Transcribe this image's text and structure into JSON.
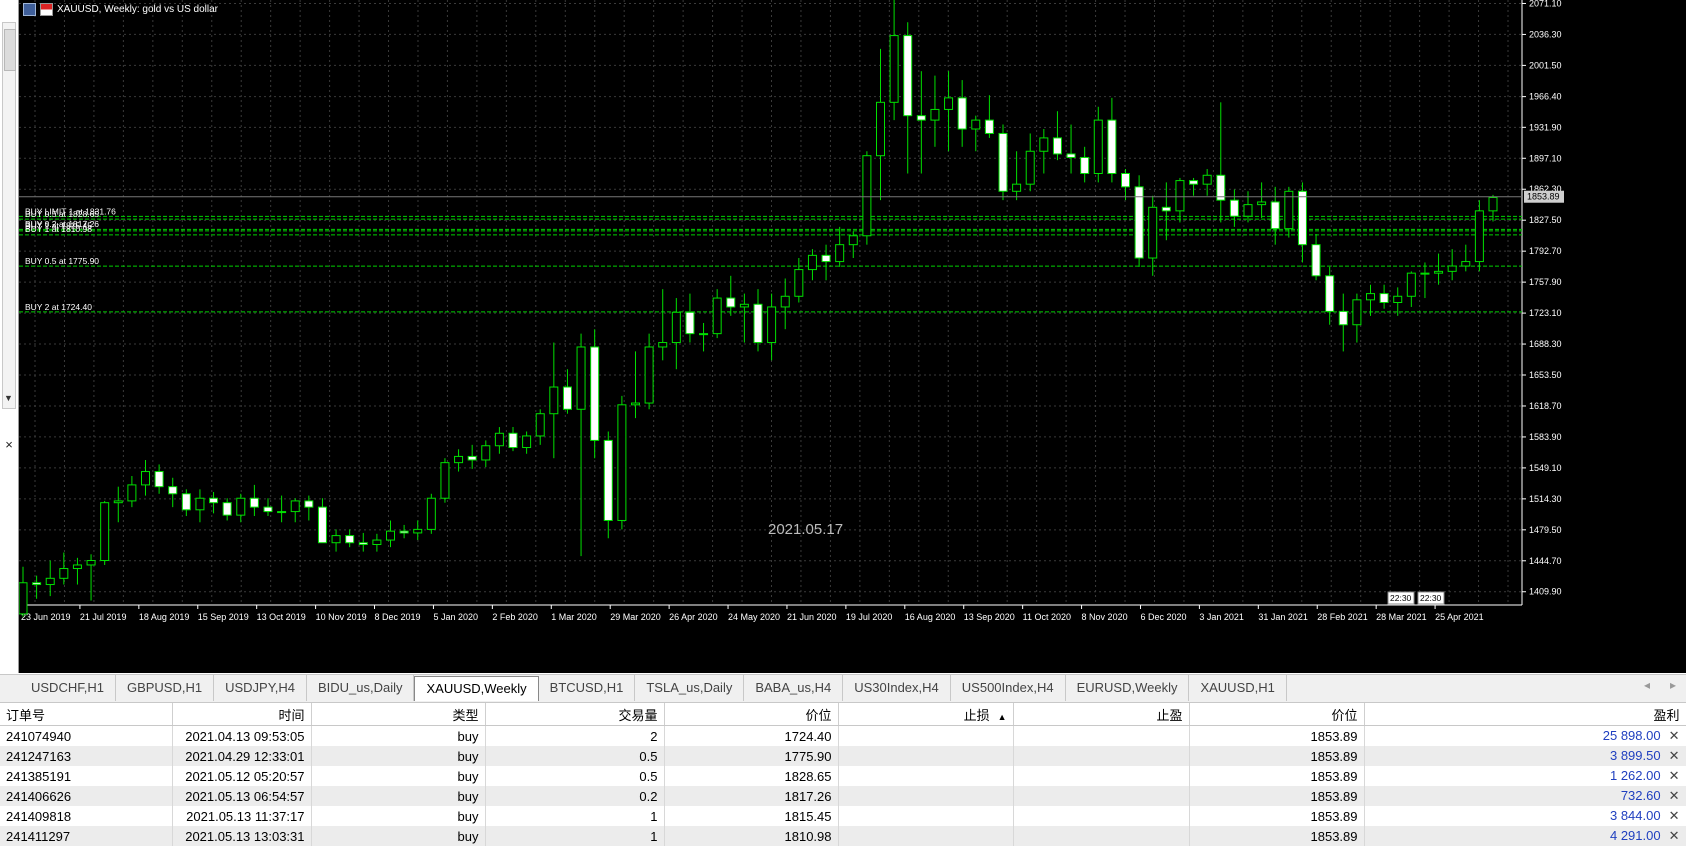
{
  "chart": {
    "title": "XAUUSD, Weekly:  gold vs US dollar",
    "date_watermark": "2021.05.17",
    "current_price": "1853.89",
    "price_ticks": [
      "2071.10",
      "2036.30",
      "2001.50",
      "1966.40",
      "1931.90",
      "1897.10",
      "1862.30",
      "1827.50",
      "1792.70",
      "1757.90",
      "1723.10",
      "1688.30",
      "1653.50",
      "1618.70",
      "1583.90",
      "1549.10",
      "1514.30",
      "1479.50",
      "1444.70",
      "1409.90"
    ],
    "date_ticks": [
      "23 Jun 2019",
      "21 Jul 2019",
      "18 Aug 2019",
      "15 Sep 2019",
      "13 Oct 2019",
      "10 Nov 2019",
      "8 Dec 2019",
      "5 Jan 2020",
      "2 Feb 2020",
      "1 Mar 2020",
      "29 Mar 2020",
      "26 Apr 2020",
      "24 May 2020",
      "21 Jun 2020",
      "19 Jul 2020",
      "16 Aug 2020",
      "13 Sep 2020",
      "11 Oct 2020",
      "8 Nov 2020",
      "6 Dec 2020",
      "3 Jan 2021",
      "31 Jan 2021",
      "28 Feb 2021",
      "28 Mar 2021",
      "25 Apr 2021"
    ],
    "order_lines": [
      {
        "label": "BUY LIMIT 1 at 1831.76",
        "price": 1831.76
      },
      {
        "label": "BUY 0.5 at 1828.65",
        "price": 1828.65
      },
      {
        "label": "BUY 0.2 at 1817.26",
        "price": 1817.26
      },
      {
        "label": "BUY 1 at 1815.45",
        "price": 1815.45
      },
      {
        "label": "BUY 1 at 1810.98",
        "price": 1810.98
      },
      {
        "label": "BUY 0.5 at 1775.90",
        "price": 1775.9
      },
      {
        "label": "BUY 2 at 1724.40",
        "price": 1724.4
      }
    ],
    "time_tags": [
      "22:30",
      "22:30"
    ],
    "colors": {
      "background": "#000000",
      "grid": "#3a3a3a",
      "candle_up": "#000000",
      "candle_down": "#ffffff",
      "wick": "#00e000",
      "order_line": "#00d000",
      "text": "#ffffff"
    }
  },
  "chart_data": {
    "type": "candlestick",
    "title": "XAUUSD, Weekly:  gold vs US dollar",
    "ylim": [
      1395,
      2075
    ],
    "candles": [
      [
        1385,
        1438,
        1382,
        1420
      ],
      [
        1420,
        1428,
        1402,
        1418
      ],
      [
        1418,
        1445,
        1405,
        1425
      ],
      [
        1425,
        1454,
        1418,
        1436
      ],
      [
        1436,
        1448,
        1418,
        1440
      ],
      [
        1440,
        1452,
        1400,
        1445
      ],
      [
        1445,
        1512,
        1440,
        1510
      ],
      [
        1510,
        1528,
        1488,
        1512
      ],
      [
        1512,
        1540,
        1505,
        1530
      ],
      [
        1530,
        1558,
        1518,
        1545
      ],
      [
        1545,
        1553,
        1520,
        1528
      ],
      [
        1528,
        1538,
        1505,
        1520
      ],
      [
        1520,
        1525,
        1495,
        1502
      ],
      [
        1502,
        1525,
        1488,
        1515
      ],
      [
        1515,
        1522,
        1498,
        1510
      ],
      [
        1510,
        1515,
        1490,
        1496
      ],
      [
        1496,
        1520,
        1488,
        1515
      ],
      [
        1515,
        1530,
        1495,
        1505
      ],
      [
        1505,
        1515,
        1495,
        1500
      ],
      [
        1500,
        1518,
        1488,
        1500
      ],
      [
        1500,
        1515,
        1488,
        1512
      ],
      [
        1512,
        1518,
        1490,
        1505
      ],
      [
        1505,
        1515,
        1465,
        1465
      ],
      [
        1465,
        1480,
        1455,
        1473
      ],
      [
        1473,
        1480,
        1460,
        1465
      ],
      [
        1465,
        1476,
        1455,
        1463
      ],
      [
        1463,
        1475,
        1455,
        1468
      ],
      [
        1468,
        1490,
        1460,
        1478
      ],
      [
        1478,
        1485,
        1470,
        1476
      ],
      [
        1476,
        1490,
        1468,
        1480
      ],
      [
        1480,
        1520,
        1475,
        1515
      ],
      [
        1515,
        1560,
        1510,
        1555
      ],
      [
        1555,
        1570,
        1545,
        1562
      ],
      [
        1562,
        1575,
        1548,
        1558
      ],
      [
        1558,
        1580,
        1550,
        1574
      ],
      [
        1574,
        1595,
        1565,
        1588
      ],
      [
        1588,
        1595,
        1568,
        1572
      ],
      [
        1572,
        1590,
        1565,
        1585
      ],
      [
        1585,
        1615,
        1575,
        1610
      ],
      [
        1610,
        1690,
        1560,
        1640
      ],
      [
        1640,
        1660,
        1610,
        1615
      ],
      [
        1615,
        1700,
        1450,
        1685
      ],
      [
        1685,
        1705,
        1560,
        1580
      ],
      [
        1580,
        1590,
        1470,
        1490
      ],
      [
        1490,
        1630,
        1480,
        1620
      ],
      [
        1620,
        1680,
        1605,
        1622
      ],
      [
        1622,
        1700,
        1615,
        1685
      ],
      [
        1685,
        1750,
        1670,
        1690
      ],
      [
        1690,
        1740,
        1660,
        1724
      ],
      [
        1724,
        1745,
        1690,
        1700
      ],
      [
        1700,
        1712,
        1680,
        1700
      ],
      [
        1700,
        1750,
        1695,
        1740
      ],
      [
        1740,
        1765,
        1720,
        1730
      ],
      [
        1730,
        1745,
        1690,
        1733
      ],
      [
        1733,
        1750,
        1680,
        1690
      ],
      [
        1690,
        1745,
        1670,
        1730
      ],
      [
        1730,
        1762,
        1705,
        1742
      ],
      [
        1742,
        1785,
        1735,
        1772
      ],
      [
        1772,
        1795,
        1760,
        1788
      ],
      [
        1788,
        1800,
        1760,
        1781
      ],
      [
        1781,
        1820,
        1775,
        1800
      ],
      [
        1800,
        1815,
        1785,
        1810
      ],
      [
        1810,
        1905,
        1800,
        1900
      ],
      [
        1900,
        2020,
        1850,
        1960
      ],
      [
        1960,
        2075,
        1940,
        2035
      ],
      [
        2035,
        2050,
        1880,
        1945
      ],
      [
        1945,
        1995,
        1880,
        1940
      ],
      [
        1940,
        1990,
        1910,
        1952
      ],
      [
        1952,
        1995,
        1905,
        1965
      ],
      [
        1965,
        1985,
        1910,
        1930
      ],
      [
        1930,
        1945,
        1905,
        1940
      ],
      [
        1940,
        1968,
        1920,
        1925
      ],
      [
        1925,
        1935,
        1850,
        1860
      ],
      [
        1860,
        1905,
        1850,
        1868
      ],
      [
        1868,
        1925,
        1860,
        1905
      ],
      [
        1905,
        1930,
        1880,
        1920
      ],
      [
        1920,
        1950,
        1895,
        1902
      ],
      [
        1902,
        1935,
        1880,
        1898
      ],
      [
        1898,
        1910,
        1870,
        1880
      ],
      [
        1880,
        1955,
        1870,
        1940
      ],
      [
        1940,
        1965,
        1870,
        1880
      ],
      [
        1880,
        1885,
        1850,
        1865
      ],
      [
        1865,
        1878,
        1775,
        1785
      ],
      [
        1785,
        1855,
        1765,
        1842
      ],
      [
        1842,
        1870,
        1805,
        1838
      ],
      [
        1838,
        1875,
        1825,
        1872
      ],
      [
        1872,
        1875,
        1855,
        1868
      ],
      [
        1868,
        1885,
        1855,
        1878
      ],
      [
        1878,
        1960,
        1825,
        1850
      ],
      [
        1850,
        1862,
        1820,
        1832
      ],
      [
        1832,
        1860,
        1825,
        1845
      ],
      [
        1845,
        1870,
        1830,
        1848
      ],
      [
        1848,
        1865,
        1800,
        1818
      ],
      [
        1818,
        1865,
        1808,
        1860
      ],
      [
        1860,
        1870,
        1780,
        1800
      ],
      [
        1800,
        1812,
        1760,
        1765
      ],
      [
        1765,
        1775,
        1710,
        1725
      ],
      [
        1725,
        1745,
        1680,
        1710
      ],
      [
        1710,
        1745,
        1690,
        1738
      ],
      [
        1738,
        1755,
        1720,
        1745
      ],
      [
        1745,
        1755,
        1728,
        1735
      ],
      [
        1735,
        1752,
        1720,
        1742
      ],
      [
        1742,
        1770,
        1730,
        1768
      ],
      [
        1768,
        1780,
        1740,
        1768
      ],
      [
        1768,
        1790,
        1755,
        1770
      ],
      [
        1770,
        1795,
        1760,
        1776
      ],
      [
        1776,
        1800,
        1770,
        1781
      ],
      [
        1781,
        1850,
        1770,
        1838
      ],
      [
        1838,
        1856,
        1826,
        1853
      ]
    ]
  },
  "tabs": {
    "items": [
      "USDCHF,H1",
      "GBPUSD,H1",
      "USDJPY,H4",
      "BIDU_us,Daily",
      "XAUUSD,Weekly",
      "BTCUSD,H1",
      "TSLA_us,Daily",
      "BABA_us,H4",
      "US30Index,H4",
      "US500Index,H4",
      "EURUSD,Weekly",
      "XAUUSD,H1"
    ],
    "active_index": 4,
    "nav_prev": "◂",
    "nav_next": "▸"
  },
  "trades": {
    "columns": [
      "订单号",
      "时间",
      "类型",
      "交易量",
      "价位",
      "止损",
      "止盈",
      "价位",
      "盈利"
    ],
    "sort_indicator": "▲",
    "rows": [
      {
        "ticket": "241074940",
        "time": "2021.04.13 09:53:05",
        "type": "buy",
        "volume": "2",
        "price_open": "1724.40",
        "sl": "",
        "tp": "",
        "price_current": "1853.89",
        "profit": "25 898.00"
      },
      {
        "ticket": "241247163",
        "time": "2021.04.29 12:33:01",
        "type": "buy",
        "volume": "0.5",
        "price_open": "1775.90",
        "sl": "",
        "tp": "",
        "price_current": "1853.89",
        "profit": "3 899.50"
      },
      {
        "ticket": "241385191",
        "time": "2021.05.12 05:20:57",
        "type": "buy",
        "volume": "0.5",
        "price_open": "1828.65",
        "sl": "",
        "tp": "",
        "price_current": "1853.89",
        "profit": "1 262.00"
      },
      {
        "ticket": "241406626",
        "time": "2021.05.13 06:54:57",
        "type": "buy",
        "volume": "0.2",
        "price_open": "1817.26",
        "sl": "",
        "tp": "",
        "price_current": "1853.89",
        "profit": "732.60"
      },
      {
        "ticket": "241409818",
        "time": "2021.05.13 11:37:17",
        "type": "buy",
        "volume": "1",
        "price_open": "1815.45",
        "sl": "",
        "tp": "",
        "price_current": "1853.89",
        "profit": "3 844.00"
      },
      {
        "ticket": "241411297",
        "time": "2021.05.13 13:03:31",
        "type": "buy",
        "volume": "1",
        "price_open": "1810.98",
        "sl": "",
        "tp": "",
        "price_current": "1853.89",
        "profit": "4 291.00"
      }
    ],
    "close_glyph": "✕"
  }
}
